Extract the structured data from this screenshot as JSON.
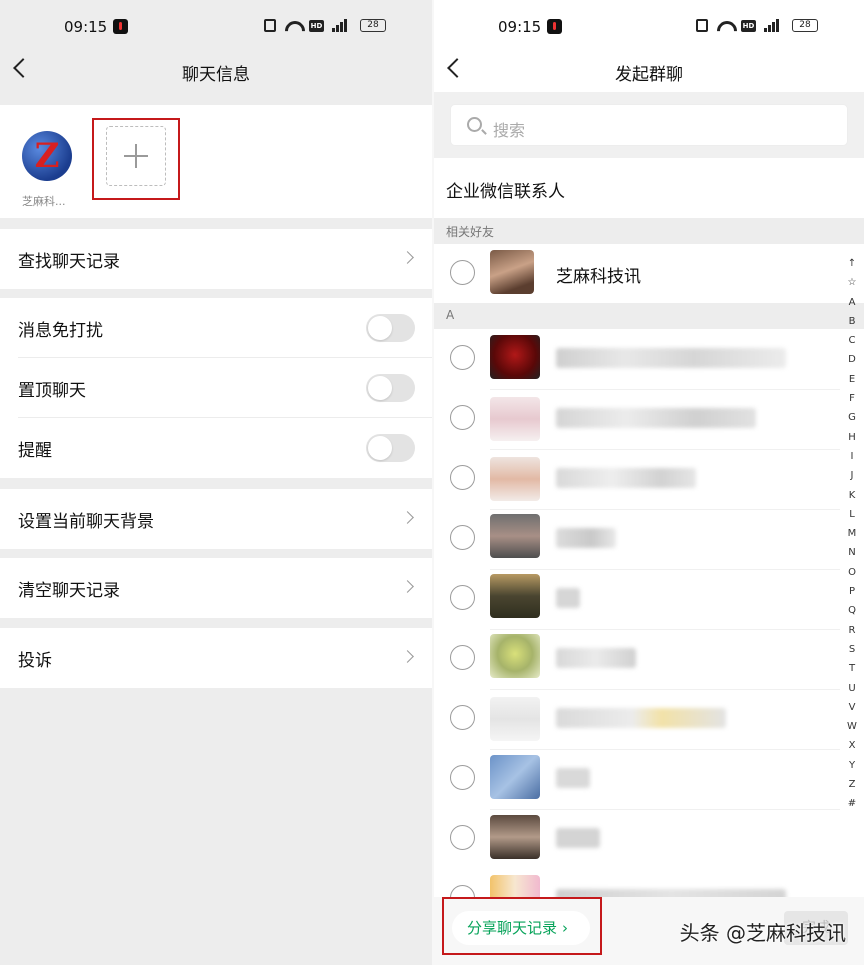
{
  "left": {
    "status": {
      "time": "09:15",
      "battery": "28",
      "net": "HD"
    },
    "nav_title": "聊天信息",
    "member_name": "芝麻科...",
    "items": {
      "find": "查找聊天记录",
      "dnd": "消息免打扰",
      "pin": "置顶聊天",
      "remind": "提醒",
      "bg": "设置当前聊天背景",
      "clear": "清空聊天记录",
      "complain": "投诉"
    }
  },
  "right": {
    "status": {
      "time": "09:15",
      "battery": "28",
      "net": "HD"
    },
    "nav_title": "发起群聊",
    "search_placeholder": "搜索",
    "enterprise": "企业微信联系人",
    "section_friends": "相关好友",
    "friend_name": "芝麻科技讯",
    "section_a": "A",
    "index": [
      "↑",
      "☆",
      "A",
      "B",
      "C",
      "D",
      "E",
      "F",
      "G",
      "H",
      "I",
      "J",
      "K",
      "L",
      "M",
      "N",
      "O",
      "P",
      "Q",
      "R",
      "S",
      "T",
      "U",
      "V",
      "W",
      "X",
      "Y",
      "Z",
      "#"
    ],
    "share_label": "分享聊天记录",
    "done_label": "完成",
    "watermark": "头条 @芝麻科技讯"
  },
  "colors": {
    "highlight": "#c5191b",
    "green": "#07a35a",
    "bg": "#ededed"
  }
}
